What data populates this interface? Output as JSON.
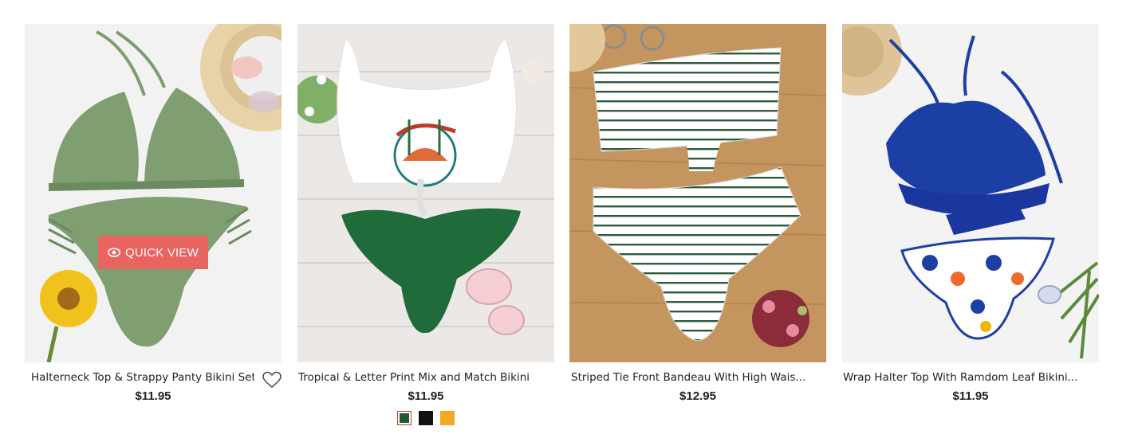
{
  "colors": {
    "accent": "#e7645f",
    "text": "#222222"
  },
  "products": [
    {
      "title": "Halterneck Top & Strappy Panty Bikini Set",
      "price": "$11.95",
      "quick_view": "QUICK VIEW",
      "icons": [
        "eye-icon",
        "heart-icon"
      ]
    },
    {
      "title": "Tropical & Letter Print Mix and Match Bikini",
      "price": "$11.95",
      "swatches": [
        "#1d5b34",
        "#111111",
        "#f5a623"
      ]
    },
    {
      "title": "Striped Tie Front Bandeau With High Wais...",
      "price": "$12.95"
    },
    {
      "title": "Wrap Halter Top With Ramdom Leaf Bikini...",
      "price": "$11.95"
    }
  ]
}
